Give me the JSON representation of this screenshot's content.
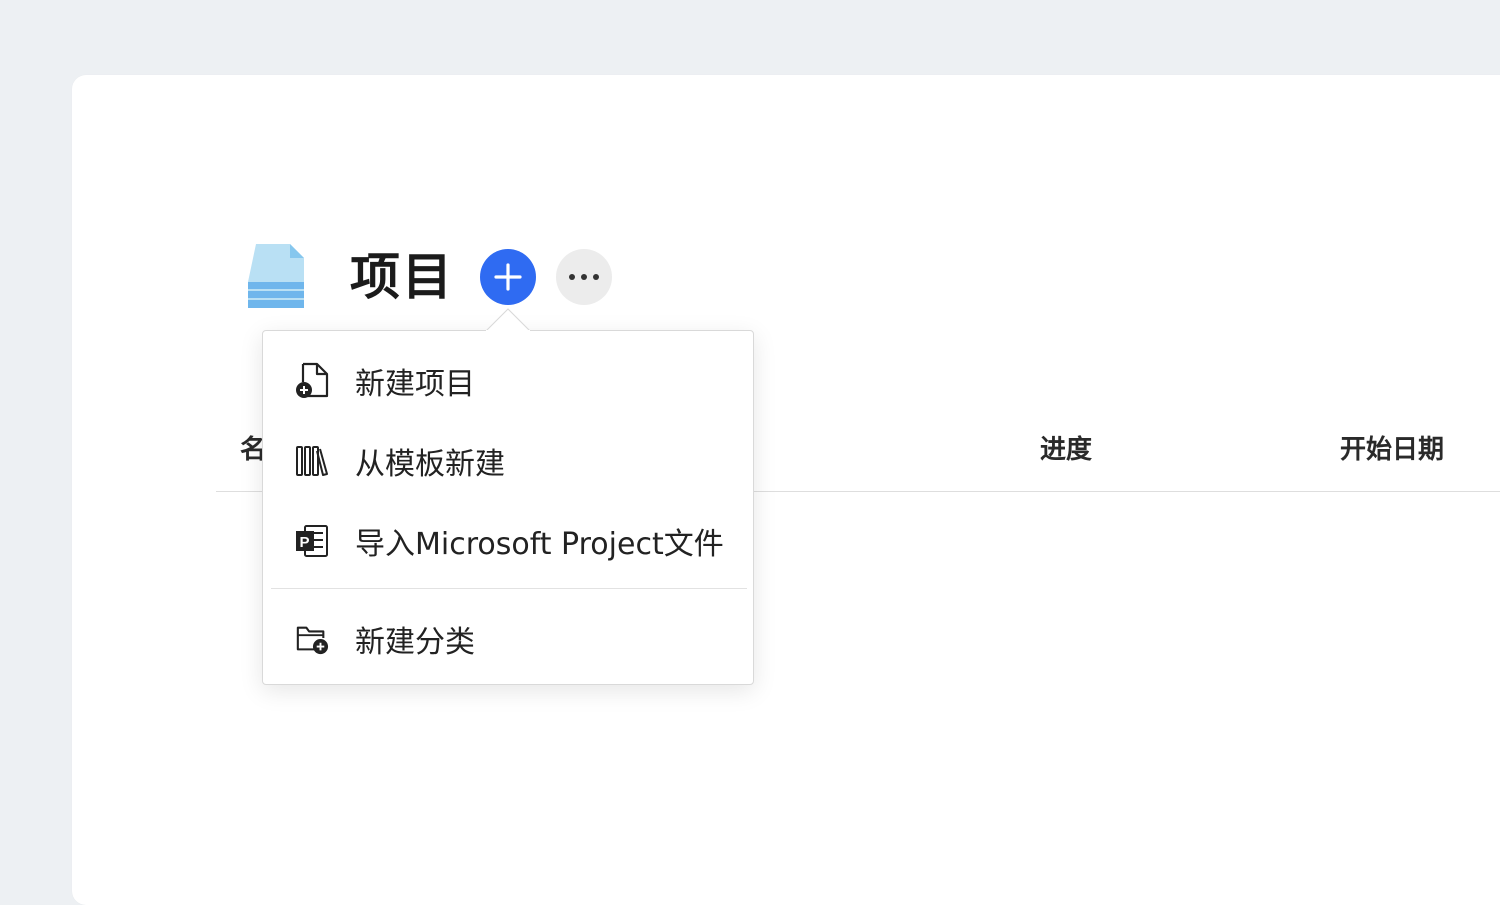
{
  "header": {
    "title": "项目",
    "folder_icon": "stacked-files-icon",
    "add_icon": "plus-icon",
    "more_icon": "ellipsis-icon",
    "accent_color": "#2f6bf2"
  },
  "table": {
    "columns": [
      "名",
      "进度",
      "开始日期"
    ]
  },
  "menu": {
    "items": [
      {
        "label": "新建项目",
        "icon": "new-file-plus-icon"
      },
      {
        "label": "从模板新建",
        "icon": "library-books-icon"
      },
      {
        "label": "导入Microsoft Project文件",
        "icon": "ms-project-icon"
      },
      {
        "label": "新建分类",
        "icon": "new-folder-plus-icon"
      }
    ]
  }
}
